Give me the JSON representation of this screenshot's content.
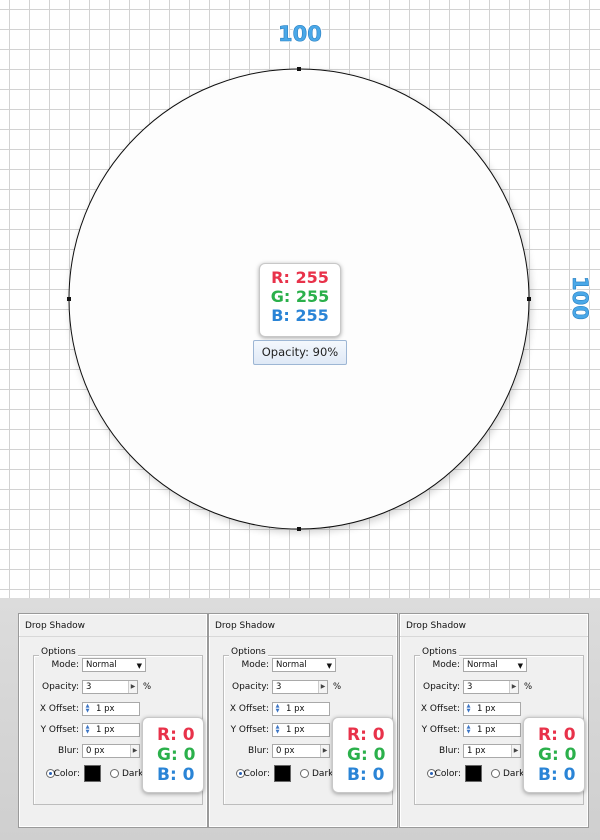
{
  "artboard": {
    "width_label": "100",
    "height_label": "100",
    "color_readout": {
      "r": "R: 255",
      "g": "G: 255",
      "b": "B: 255"
    },
    "opacity_tooltip": "Opacity: 90%",
    "colors": {
      "grid": "#d2d2d2",
      "label": "#4aa8e8",
      "r": "#e8324a",
      "g": "#2bb04b",
      "b": "#2a84d6"
    }
  },
  "panels": [
    {
      "title": "Drop Shadow",
      "options_legend": "Options",
      "mode_label": "Mode:",
      "mode_value": "Normal",
      "opacity_label": "Opacity:",
      "opacity_value": "3",
      "opacity_unit": "%",
      "x_offset_label": "X Offset:",
      "x_offset_value": "1 px",
      "y_offset_label": "Y Offset:",
      "y_offset_value": "1 px",
      "blur_label": "Blur:",
      "blur_value": "0 px",
      "color_label": "Color:",
      "darkness_label": "Darkne",
      "color_readout": {
        "r": "R: 0",
        "g": "G: 0",
        "b": "B: 0"
      }
    },
    {
      "title": "Drop Shadow",
      "options_legend": "Options",
      "mode_label": "Mode:",
      "mode_value": "Normal",
      "opacity_label": "Opacity:",
      "opacity_value": "3",
      "opacity_unit": "%",
      "x_offset_label": "X Offset:",
      "x_offset_value": "1 px",
      "y_offset_label": "Y Offset:",
      "y_offset_value": "1 px",
      "blur_label": "Blur:",
      "blur_value": "0 px",
      "color_label": "Color:",
      "darkness_label": "Darkne",
      "color_readout": {
        "r": "R: 0",
        "g": "G: 0",
        "b": "B: 0"
      }
    },
    {
      "title": "Drop Shadow",
      "options_legend": "Options",
      "mode_label": "Mode:",
      "mode_value": "Normal",
      "opacity_label": "Opacity:",
      "opacity_value": "3",
      "opacity_unit": "%",
      "x_offset_label": "X Offset:",
      "x_offset_value": "1 px",
      "y_offset_label": "Y Offset:",
      "y_offset_value": "1 px",
      "blur_label": "Blur:",
      "blur_value": "1 px",
      "color_label": "Color:",
      "darkness_label": "Darkne",
      "color_readout": {
        "r": "R: 0",
        "g": "G: 0",
        "b": "B: 0"
      }
    }
  ]
}
